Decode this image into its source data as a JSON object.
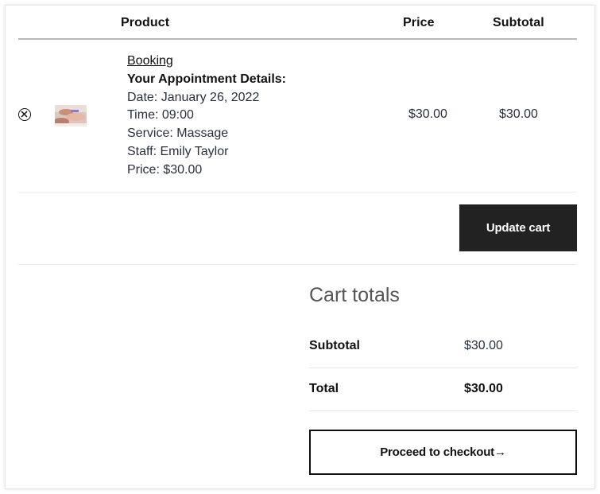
{
  "table": {
    "headers": {
      "product": "Product",
      "price": "Price",
      "subtotal": "Subtotal"
    }
  },
  "cart_item": {
    "remove_icon": "close-circle-icon",
    "thumbnail": "massage-photo-thumbnail",
    "name": "Booking",
    "details_heading": "Your Appointment Details:",
    "date": "Date: January 26, 2022",
    "time": "Time: 09:00",
    "service": "Service: Massage",
    "staff": "Staff: Emily Taylor",
    "price_line": "Price: $30.00",
    "price": "$30.00",
    "subtotal": "$30.00"
  },
  "actions": {
    "update_cart": "Update cart"
  },
  "cart_totals": {
    "title": "Cart totals",
    "subtotal_label": "Subtotal",
    "subtotal_value": "$30.00",
    "total_label": "Total",
    "total_value": "$30.00",
    "checkout_button": "Proceed to checkout→"
  },
  "colors": {
    "button_dark": "#222222",
    "text": "#28303d",
    "rule": "#b9b9b9"
  }
}
